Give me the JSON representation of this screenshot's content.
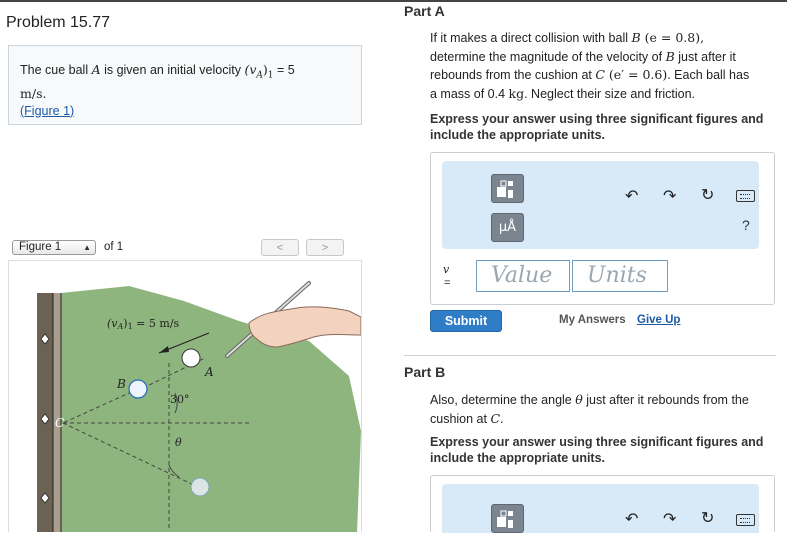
{
  "problem": {
    "title": "Problem 15.77",
    "intro_prefix": "The cue ball ",
    "intro_ball": "A",
    "intro_mid": " is given an initial velocity ",
    "intro_velocity": "(v",
    "intro_velocity_sub": "A",
    "intro_velocity_close": ")",
    "intro_velocity_sub2": "1",
    "intro_equals": " = 5",
    "intro_units": "m/s.",
    "figure_link": "(Figure 1)"
  },
  "figure": {
    "select_value": "Figure 1",
    "of_label": "of 1",
    "prev": "<",
    "next": ">",
    "labels": {
      "velocity": "(v",
      "velocity_sub": "A",
      "velocity_rest": ")",
      "velocity_sub2": "1",
      "velocity_value": " = 5 m/s",
      "ball_a": "A",
      "ball_b": "B",
      "point_c": "C",
      "angle": "30°",
      "theta": "θ"
    }
  },
  "part_a": {
    "label": "Part A",
    "q1": "If it makes a direct collision with ball ",
    "q_b": "B",
    "q_e": " (e = 0.8),",
    "q2": "determine the magnitude of the velocity of ",
    "q2b": " just after it",
    "q3": "rebounds from the cushion at ",
    "q_c": "C",
    "q_eprime": " (e′ = 0.6)",
    "q3b": ". Each ball has",
    "q4": "a mass of 0.4 ",
    "q_kg": "kg",
    "q4b": ". Neglect their size and friction.",
    "instructions": "Express your answer using three significant figures and include the appropriate units.",
    "toolbar": {
      "units_btn": "μÅ",
      "help": "?"
    },
    "variable": "v",
    "equals": "=",
    "value_placeholder": "Value",
    "units_placeholder": "Units",
    "submit": "Submit",
    "my_answers": "My Answers",
    "give_up": "Give Up"
  },
  "part_b": {
    "label": "Part B",
    "q1": "Also, determine the angle ",
    "q_theta": "θ",
    "q1b": " just after it rebounds from the",
    "q2": "cushion at ",
    "q_c": "C",
    "q2b": ".",
    "instructions": "Express your answer using three significant figures and include the appropriate units."
  },
  "colors": {
    "link": "#1d5aa6",
    "submit": "#2f7dc6",
    "tool_panel": "#d8e9f8",
    "table_green": "#8fb57e",
    "rail_brown": "#6b6254"
  }
}
